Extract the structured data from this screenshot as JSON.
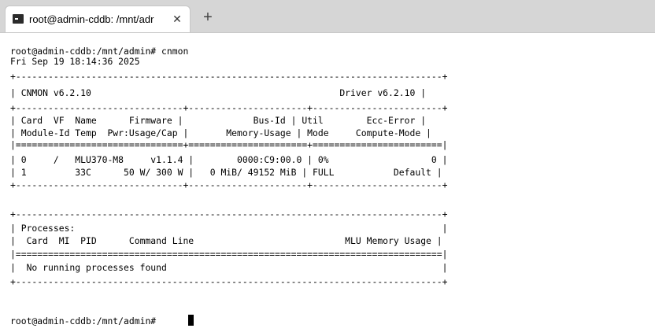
{
  "tab": {
    "title": "root@admin-cddb: /mnt/adr",
    "close_glyph": "✕",
    "new_tab_glyph": "+"
  },
  "terminal": {
    "lines": [
      "root@admin-cddb:/mnt/admin# cnmon",
      "Fri Sep 19 18:14:36 2025",
      "+-------------------------------------------------------------------------------+",
      "| CNMON v6.2.10                                              Driver v6.2.10 |",
      "+-------------------------------+----------------------+------------------------+",
      "| Card  VF  Name      Firmware |             Bus-Id | Util        Ecc-Error |",
      "| Module-Id Temp  Pwr:Usage/Cap |       Memory-Usage | Mode     Compute-Mode |",
      "|===============================+======================+========================|",
      "| 0     /   MLU370-M8     v1.1.4 |        0000:C9:00.0 | 0%                   0 |",
      "| 1         33C      50 W/ 300 W |   0 MiB/ 49152 MiB | FULL           Default |",
      "+-------------------------------+----------------------+------------------------+",
      "",
      "+-------------------------------------------------------------------------------+",
      "| Processes:                                                                    |",
      "|  Card  MI  PID      Command Line                            MLU Memory Usage |",
      "|===============================================================================|",
      "|  No running processes found                                                   |",
      "+-------------------------------------------------------------------------------+",
      "",
      "",
      "root@admin-cddb:/mnt/admin# "
    ]
  }
}
